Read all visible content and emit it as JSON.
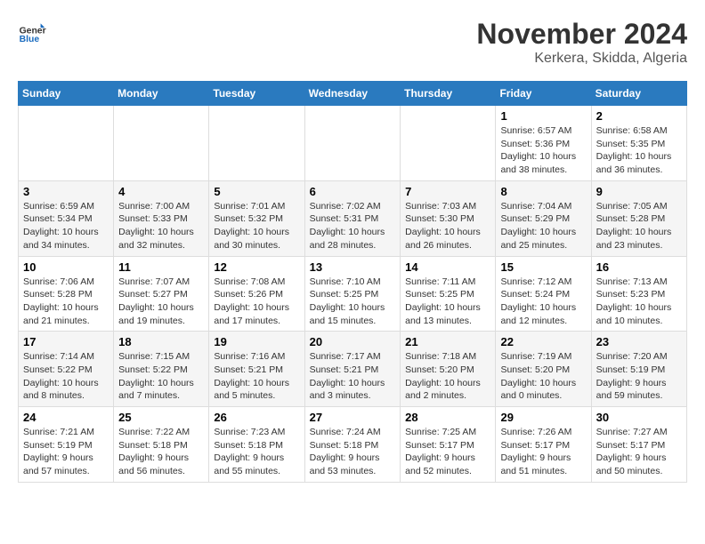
{
  "header": {
    "logo_general": "General",
    "logo_blue": "Blue",
    "month_title": "November 2024",
    "location": "Kerkera, Skidda, Algeria"
  },
  "days_of_week": [
    "Sunday",
    "Monday",
    "Tuesday",
    "Wednesday",
    "Thursday",
    "Friday",
    "Saturday"
  ],
  "weeks": [
    [
      {
        "day": "",
        "info": ""
      },
      {
        "day": "",
        "info": ""
      },
      {
        "day": "",
        "info": ""
      },
      {
        "day": "",
        "info": ""
      },
      {
        "day": "",
        "info": ""
      },
      {
        "day": "1",
        "info": "Sunrise: 6:57 AM\nSunset: 5:36 PM\nDaylight: 10 hours\nand 38 minutes."
      },
      {
        "day": "2",
        "info": "Sunrise: 6:58 AM\nSunset: 5:35 PM\nDaylight: 10 hours\nand 36 minutes."
      }
    ],
    [
      {
        "day": "3",
        "info": "Sunrise: 6:59 AM\nSunset: 5:34 PM\nDaylight: 10 hours\nand 34 minutes."
      },
      {
        "day": "4",
        "info": "Sunrise: 7:00 AM\nSunset: 5:33 PM\nDaylight: 10 hours\nand 32 minutes."
      },
      {
        "day": "5",
        "info": "Sunrise: 7:01 AM\nSunset: 5:32 PM\nDaylight: 10 hours\nand 30 minutes."
      },
      {
        "day": "6",
        "info": "Sunrise: 7:02 AM\nSunset: 5:31 PM\nDaylight: 10 hours\nand 28 minutes."
      },
      {
        "day": "7",
        "info": "Sunrise: 7:03 AM\nSunset: 5:30 PM\nDaylight: 10 hours\nand 26 minutes."
      },
      {
        "day": "8",
        "info": "Sunrise: 7:04 AM\nSunset: 5:29 PM\nDaylight: 10 hours\nand 25 minutes."
      },
      {
        "day": "9",
        "info": "Sunrise: 7:05 AM\nSunset: 5:28 PM\nDaylight: 10 hours\nand 23 minutes."
      }
    ],
    [
      {
        "day": "10",
        "info": "Sunrise: 7:06 AM\nSunset: 5:28 PM\nDaylight: 10 hours\nand 21 minutes."
      },
      {
        "day": "11",
        "info": "Sunrise: 7:07 AM\nSunset: 5:27 PM\nDaylight: 10 hours\nand 19 minutes."
      },
      {
        "day": "12",
        "info": "Sunrise: 7:08 AM\nSunset: 5:26 PM\nDaylight: 10 hours\nand 17 minutes."
      },
      {
        "day": "13",
        "info": "Sunrise: 7:10 AM\nSunset: 5:25 PM\nDaylight: 10 hours\nand 15 minutes."
      },
      {
        "day": "14",
        "info": "Sunrise: 7:11 AM\nSunset: 5:25 PM\nDaylight: 10 hours\nand 13 minutes."
      },
      {
        "day": "15",
        "info": "Sunrise: 7:12 AM\nSunset: 5:24 PM\nDaylight: 10 hours\nand 12 minutes."
      },
      {
        "day": "16",
        "info": "Sunrise: 7:13 AM\nSunset: 5:23 PM\nDaylight: 10 hours\nand 10 minutes."
      }
    ],
    [
      {
        "day": "17",
        "info": "Sunrise: 7:14 AM\nSunset: 5:22 PM\nDaylight: 10 hours\nand 8 minutes."
      },
      {
        "day": "18",
        "info": "Sunrise: 7:15 AM\nSunset: 5:22 PM\nDaylight: 10 hours\nand 7 minutes."
      },
      {
        "day": "19",
        "info": "Sunrise: 7:16 AM\nSunset: 5:21 PM\nDaylight: 10 hours\nand 5 minutes."
      },
      {
        "day": "20",
        "info": "Sunrise: 7:17 AM\nSunset: 5:21 PM\nDaylight: 10 hours\nand 3 minutes."
      },
      {
        "day": "21",
        "info": "Sunrise: 7:18 AM\nSunset: 5:20 PM\nDaylight: 10 hours\nand 2 minutes."
      },
      {
        "day": "22",
        "info": "Sunrise: 7:19 AM\nSunset: 5:20 PM\nDaylight: 10 hours\nand 0 minutes."
      },
      {
        "day": "23",
        "info": "Sunrise: 7:20 AM\nSunset: 5:19 PM\nDaylight: 9 hours\nand 59 minutes."
      }
    ],
    [
      {
        "day": "24",
        "info": "Sunrise: 7:21 AM\nSunset: 5:19 PM\nDaylight: 9 hours\nand 57 minutes."
      },
      {
        "day": "25",
        "info": "Sunrise: 7:22 AM\nSunset: 5:18 PM\nDaylight: 9 hours\nand 56 minutes."
      },
      {
        "day": "26",
        "info": "Sunrise: 7:23 AM\nSunset: 5:18 PM\nDaylight: 9 hours\nand 55 minutes."
      },
      {
        "day": "27",
        "info": "Sunrise: 7:24 AM\nSunset: 5:18 PM\nDaylight: 9 hours\nand 53 minutes."
      },
      {
        "day": "28",
        "info": "Sunrise: 7:25 AM\nSunset: 5:17 PM\nDaylight: 9 hours\nand 52 minutes."
      },
      {
        "day": "29",
        "info": "Sunrise: 7:26 AM\nSunset: 5:17 PM\nDaylight: 9 hours\nand 51 minutes."
      },
      {
        "day": "30",
        "info": "Sunrise: 7:27 AM\nSunset: 5:17 PM\nDaylight: 9 hours\nand 50 minutes."
      }
    ]
  ]
}
